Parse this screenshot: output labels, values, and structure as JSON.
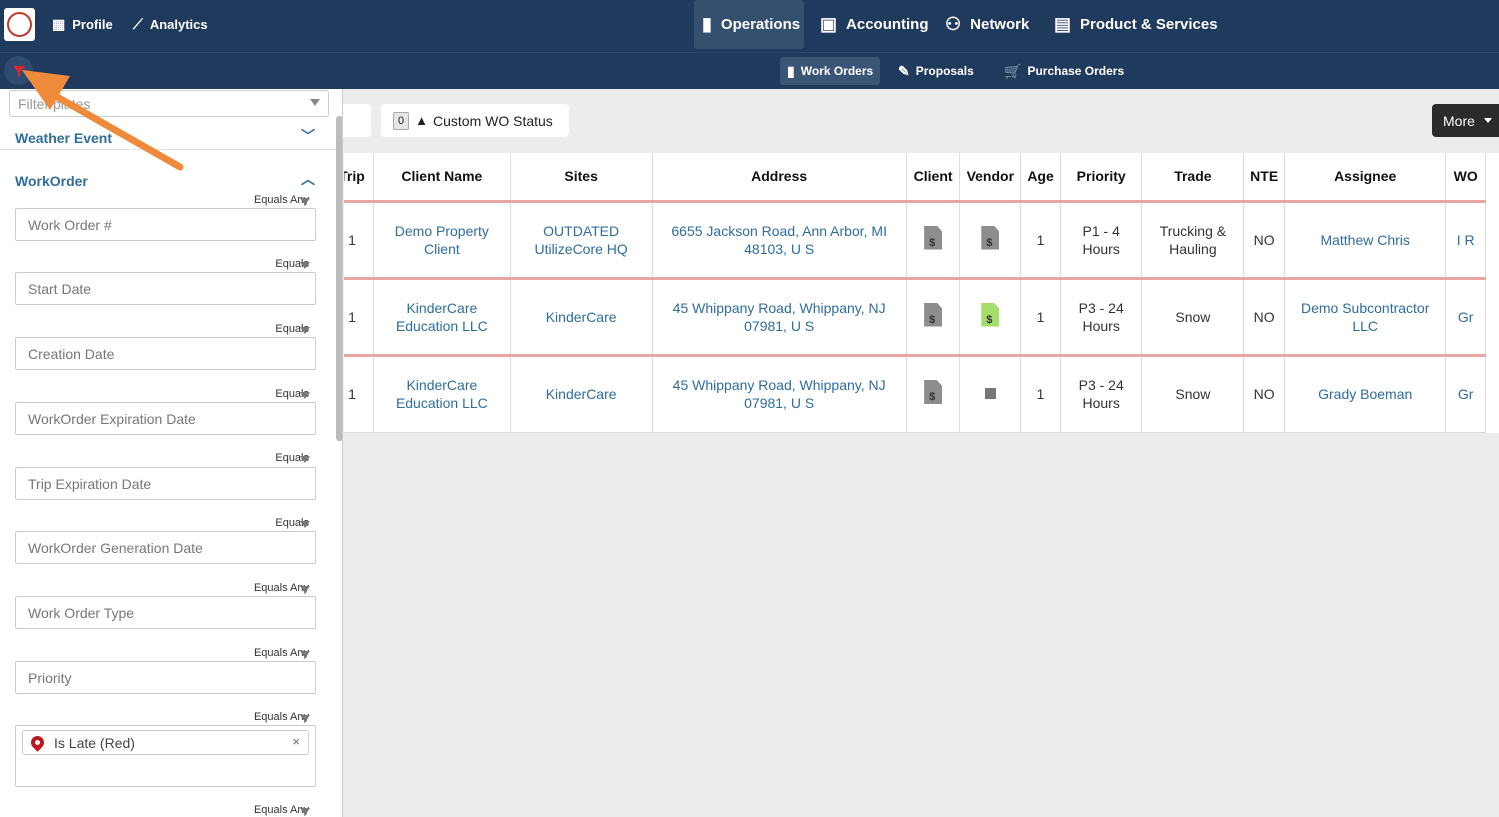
{
  "topnav": {
    "left": [
      {
        "label": "Profile",
        "icon": "building-icon"
      },
      {
        "label": "Analytics",
        "icon": "chart-line-icon"
      }
    ],
    "main": [
      {
        "label": "Operations",
        "icon": "clipboard-user-icon",
        "active": true
      },
      {
        "label": "Accounting",
        "icon": "money-check-icon",
        "active": false
      },
      {
        "label": "Network",
        "icon": "network-users-icon",
        "active": false
      },
      {
        "label": "Product & Services",
        "icon": "briefcase-icon",
        "active": false
      }
    ]
  },
  "subnav": [
    {
      "label": "Work Orders",
      "icon": "clipboard-icon",
      "active": true
    },
    {
      "label": "Proposals",
      "icon": "file-signature-icon",
      "active": false
    },
    {
      "label": "Purchase Orders",
      "icon": "shopping-cart-icon",
      "active": false
    }
  ],
  "sidebar": {
    "template_placeholder": "Filter Templates",
    "template_visible": "Filter      plates",
    "weather_section": "Weather Event",
    "workorder_section": "WorkOrder",
    "filters": [
      {
        "op": "Equals Any",
        "placeholder": "Work Order #"
      },
      {
        "op": "Equals",
        "placeholder": "Start Date"
      },
      {
        "op": "Equals",
        "placeholder": "Creation Date"
      },
      {
        "op": "Equals",
        "placeholder": "WorkOrder Expiration Date"
      },
      {
        "op": "Equals",
        "placeholder": "Trip Expiration Date"
      },
      {
        "op": "Equals",
        "placeholder": "WorkOrder Generation Date"
      },
      {
        "op": "Equals Any",
        "placeholder": "Work Order Type"
      },
      {
        "op": "Equals Any",
        "placeholder": "Priority"
      },
      {
        "op": "Equals Any",
        "tag": "Is Late (Red)"
      },
      {
        "op": "Equals Any"
      }
    ]
  },
  "toolbar": {
    "custom_status_count": "0",
    "custom_status_label": "Custom WO Status",
    "more_label": "More"
  },
  "table": {
    "headers": [
      "Trip",
      "Client Name",
      "Sites",
      "Address",
      "Client",
      "Vendor",
      "Age",
      "Priority",
      "Trade",
      "NTE",
      "Assignee",
      "WO"
    ],
    "rows": [
      {
        "trip": "1",
        "client": "Demo Property Client",
        "site": "OUTDATED UtilizeCore HQ",
        "address": "6655 Jackson Road, Ann Arbor, MI 48103, U S",
        "client_doc": "gray",
        "vendor_doc": "gray",
        "age": "1",
        "priority": "P1 - 4 Hours",
        "trade": "Trucking & Hauling",
        "nte": "NO",
        "assignee": "Matthew Chris",
        "wo": "I R"
      },
      {
        "trip": "1",
        "client": "KinderCare Education LLC",
        "site": "KinderCare",
        "address": "45 Whippany Road, Whippany, NJ 07981, U S",
        "client_doc": "gray",
        "vendor_doc": "green",
        "age": "1",
        "priority": "P3 - 24 Hours",
        "trade": "Snow",
        "nte": "NO",
        "assignee": "Demo Subcontractor LLC",
        "wo": "Gr"
      },
      {
        "trip": "1",
        "client": "KinderCare Education LLC",
        "site": "KinderCare",
        "address": "45 Whippany Road, Whippany, NJ 07981, U S",
        "client_doc": "gray",
        "vendor_doc": "square",
        "age": "1",
        "priority": "P3 - 24 Hours",
        "trade": "Snow",
        "nte": "NO",
        "assignee": "Grady Boeman",
        "wo": "Gr"
      }
    ]
  },
  "colors": {
    "nav_bg": "#1f3a5c",
    "link": "#2f6d9e",
    "row_border": "#e8a6a0",
    "annotation_arrow": "#ef8a3a"
  }
}
